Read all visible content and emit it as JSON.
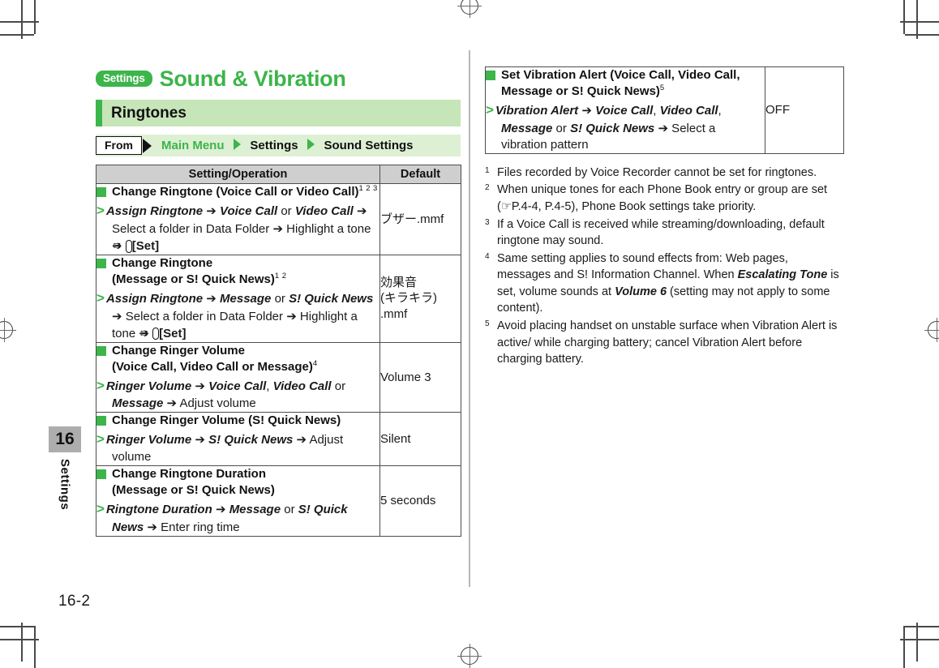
{
  "page": {
    "folio": "16-2",
    "chapter_number": "16",
    "chapter_label": "Settings"
  },
  "header": {
    "badge": "Settings",
    "title": "Sound & Vibration",
    "section": "Ringtones",
    "from_label": "From",
    "breadcrumb": [
      "Main Menu",
      "Settings",
      "Sound Settings"
    ]
  },
  "colors": {
    "accent_green": "#3cb54a",
    "band_green": "#c6e5b9",
    "from_band_green": "#ddf0d4",
    "header_gray": "#cfcfcf",
    "tab_gray": "#adadad"
  },
  "left_table": {
    "columns": [
      "Setting/Operation",
      "Default"
    ],
    "rows": [
      {
        "heading": "Change Ringtone (Voice Call or Video Call)",
        "heading_cont": "",
        "footnote_marks": "1 2 3",
        "operation_html": "<span class=\"gt\">&gt;</span><b>Assign Ringtone</b> <span class=\"arr\">&#10132;</span> <b>Voice Call</b> or <b>Video Call</b> <span class=\"arr\">&#10132;</span> Select a folder in Data Folder <span class=\"arr\">&#10132;</span> Highlight a tone <span class=\"arr\">&#10132;</span> <span class=\"keybox\">&#9993;</span><span class=\"setlbl\">[Set]</span>",
        "default": "ブザー.mmf"
      },
      {
        "heading": "Change Ringtone",
        "heading_cont": "(Message or S! Quick News)",
        "footnote_marks": "1 2",
        "operation_html": "<span class=\"gt\">&gt;</span><b>Assign Ringtone</b> <span class=\"arr\">&#10132;</span> <b>Message</b> or <b>S! Quick News</b> <span class=\"arr\">&#10132;</span> Select a folder in Data Folder <span class=\"arr\">&#10132;</span> Highlight a tone <span class=\"arr\">&#10132;</span> <span class=\"keybox\">&#9993;</span><span class=\"setlbl\">[Set]</span>",
        "default": "効果音\n(キラキラ)\n.mmf"
      },
      {
        "heading": "Change Ringer Volume",
        "heading_cont": "(Voice Call, Video Call or Message)",
        "footnote_marks": "4",
        "operation_html": "<span class=\"gt\">&gt;</span><b>Ringer Volume</b> <span class=\"arr\">&#10132;</span> <b>Voice Call</b>, <b>Video Call</b> or <b>Message</b> <span class=\"arr\">&#10132;</span> Adjust volume",
        "default": "Volume 3"
      },
      {
        "heading": "Change Ringer Volume (S! Quick News)",
        "heading_cont": "",
        "footnote_marks": "",
        "operation_html": "<span class=\"gt\">&gt;</span><b>Ringer Volume</b> <span class=\"arr\">&#10132;</span> <b>S! Quick News</b> <span class=\"arr\">&#10132;</span> Adjust volume",
        "default": "Silent"
      },
      {
        "heading": "Change Ringtone Duration",
        "heading_cont": "(Message or S! Quick News)",
        "footnote_marks": "",
        "operation_html": "<span class=\"gt\">&gt;</span><b>Ringtone Duration</b> <span class=\"arr\">&#10132;</span> <b>Message</b> or <b>S! Quick News</b> <span class=\"arr\">&#10132;</span> Enter ring time",
        "default": "5 seconds"
      }
    ]
  },
  "right_table": {
    "rows": [
      {
        "heading": "Set Vibration Alert (Voice Call, Video Call,",
        "heading_cont": "Message or S! Quick News)",
        "footnote_marks": "5",
        "operation_html": "<span class=\"gt\">&gt;</span><b>Vibration Alert</b> <span class=\"arr\">&#10132;</span> <b>Voice Call</b>, <b>Video Call</b>, <b>Message</b> or <b>S! Quick News</b> <span class=\"arr\">&#10132;</span> Select a vibration pattern",
        "default": "OFF"
      }
    ]
  },
  "footnotes": [
    {
      "num": "1",
      "text_html": "Files recorded by Voice Recorder cannot be set for ringtones."
    },
    {
      "num": "2",
      "text_html": "When unique tones for each Phone Book entry or group are set (<span class=\"hand\">&#9758;</span>P.4-4, P.4-5), Phone Book settings take priority."
    },
    {
      "num": "3",
      "text_html": "If a Voice Call is received while streaming/downloading, default ringtone may sound."
    },
    {
      "num": "4",
      "text_html": "Same setting applies to sound effects from: Web pages, messages and S! Information Channel. When <b>Escalating Tone</b> is set, volume sounds at <b>Volume 6</b> (setting may not apply to some content)."
    },
    {
      "num": "5",
      "text_html": "Avoid placing handset on unstable surface when Vibration Alert is active/ while charging battery; cancel Vibration Alert before charging battery."
    }
  ]
}
